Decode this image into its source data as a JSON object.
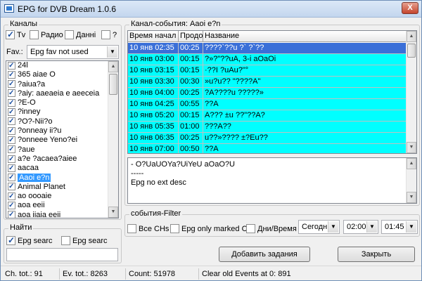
{
  "window": {
    "title": "EPG for DVB Dream 1.0.6",
    "close_symbol": "X"
  },
  "channels_group": {
    "title": "Каналы",
    "filters": [
      {
        "label": "Tv",
        "checked": true
      },
      {
        "label": "Радио",
        "checked": false
      },
      {
        "label": "Данні",
        "checked": false
      },
      {
        "label": "?",
        "checked": false
      }
    ],
    "fav_label": "Fav.:",
    "fav_value": "Epg fav not used",
    "items": [
      {
        "label": "24l",
        "checked": true
      },
      {
        "label": "365 aiae O",
        "checked": true
      },
      {
        "label": "?aiua?a",
        "checked": true
      },
      {
        "label": "?aiy: aaeaeia e aeeceia",
        "checked": true
      },
      {
        "label": "?E-O",
        "checked": true
      },
      {
        "label": "?inney",
        "checked": true
      },
      {
        "label": "?O?-Nii?o",
        "checked": true
      },
      {
        "label": "?onneay ii?u",
        "checked": true
      },
      {
        "label": "?onneee Yeno?ei",
        "checked": true
      },
      {
        "label": "?aue",
        "checked": true
      },
      {
        "label": "a?e ?acaea?aiee",
        "checked": true
      },
      {
        "label": "aacaa",
        "checked": true
      },
      {
        "label": "Aaoi e?n",
        "checked": true,
        "selected": true
      },
      {
        "label": "Animal Planet",
        "checked": true
      },
      {
        "label": "ao oooaie",
        "checked": true
      },
      {
        "label": "aoa eeii",
        "checked": true
      },
      {
        "label": "aoa iiaia eeii",
        "checked": true
      },
      {
        "label": "aoa iiaia - 5 aeee",
        "checked": true
      }
    ]
  },
  "find_group": {
    "title": "Найти",
    "options": [
      {
        "label": "Epg searc",
        "checked": true
      },
      {
        "label": "Epg searc",
        "checked": false
      }
    ],
    "search_value": ""
  },
  "events_group": {
    "title": "Канал-события: Aaoi e?n",
    "columns": [
      "Время начал",
      "Продо",
      "Название"
    ],
    "rows": [
      {
        "start": "10 янв 02:35",
        "duration": "00:25",
        "name": "????`??u ?` ?`??",
        "selected": true
      },
      {
        "start": "10 янв 03:00",
        "duration": "00:15",
        "name": "?»?\"??uA, 3-i aOaOi"
      },
      {
        "start": "10 янв 03:15",
        "duration": "00:15",
        "name": "·??I ?uAu?\"°"
      },
      {
        "start": "10 янв 03:30",
        "duration": "00:30",
        "name": "»u?u?? \"????A\""
      },
      {
        "start": "10 янв 04:00",
        "duration": "00:25",
        "name": "?A????u ?????»"
      },
      {
        "start": "10 янв 04:25",
        "duration": "00:55",
        "name": "??A"
      },
      {
        "start": "10 янв 05:20",
        "duration": "00:15",
        "name": "A??? ±u ??\"??A?"
      },
      {
        "start": "10 янв 05:35",
        "duration": "01:00",
        "name": "???A??"
      },
      {
        "start": "10 янв 06:35",
        "duration": "00:25",
        "name": "u??»???? ±?Eu??"
      },
      {
        "start": "10 янв 07:00",
        "duration": "00:50",
        "name": "??A"
      }
    ],
    "description_lines": [
      "- O?UaUOYa?UiYeU aOaO?U",
      "-----",
      "Epg no ext desc"
    ]
  },
  "filter_group": {
    "title": "события-Filter",
    "options": [
      {
        "label": "Все CHs",
        "checked": false
      },
      {
        "label": "Epg only marked C",
        "checked": false
      },
      {
        "label": "Дни/Время",
        "checked": false
      }
    ],
    "day_value": "Сегодн",
    "time_from": "02:00",
    "time_to": "01:45"
  },
  "buttons": {
    "add_tasks": "Добавить задания",
    "close": "Закрыть"
  },
  "status": {
    "channels_total": "Ch. tot.: 91",
    "events_total": "Ev. tot.: 8263",
    "count": "Count: 51978",
    "clear_old": "Clear old Events at 0: 891"
  }
}
